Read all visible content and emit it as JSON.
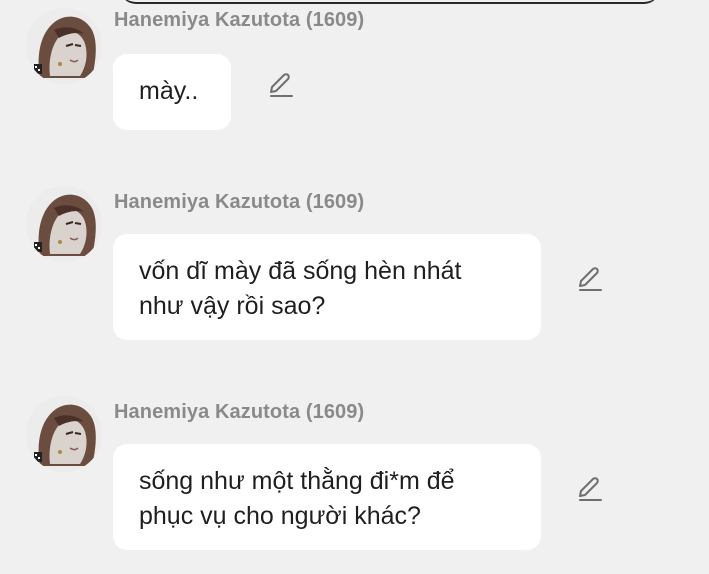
{
  "messages": [
    {
      "sender": "Hanemiya Kazutota (1609)",
      "lines": [
        "mày.."
      ],
      "avatar_icon": "avatar-icon",
      "edit_icon": "edit-icon"
    },
    {
      "sender": "Hanemiya Kazutota (1609)",
      "lines": [
        "vốn dĩ mày đã sống hèn nhát",
        "như vậy rồi sao?"
      ],
      "avatar_icon": "avatar-icon",
      "edit_icon": "edit-icon"
    },
    {
      "sender": "Hanemiya Kazutota (1609)",
      "lines": [
        "sống như một thằng đi*m để",
        "phục vụ cho người khác?"
      ],
      "avatar_icon": "avatar-icon",
      "edit_icon": "edit-icon"
    }
  ],
  "colors": {
    "background": "#f0f0f0",
    "bubble": "#ffffff",
    "sender_text": "#8a8a8a",
    "message_text": "#1f1f1f",
    "icon": "#6f6f6f"
  }
}
